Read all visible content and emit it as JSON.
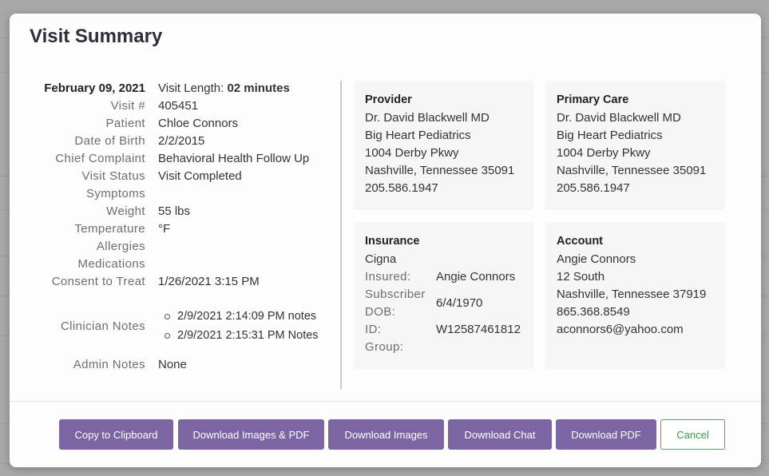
{
  "modal": {
    "title": "Visit Summary"
  },
  "visit": {
    "date": "February 09, 2021",
    "length_label": "Visit Length:",
    "length_value": "02 minutes",
    "fields": [
      {
        "label": "Visit #",
        "value": "405451"
      },
      {
        "label": "Patient",
        "value": "Chloe Connors"
      },
      {
        "label": "Date of Birth",
        "value": "2/2/2015"
      },
      {
        "label": "Chief Complaint",
        "value": "Behavioral Health Follow Up"
      },
      {
        "label": "Visit Status",
        "value": "Visit Completed"
      },
      {
        "label": "Symptoms",
        "value": ""
      },
      {
        "label": "Weight",
        "value": "55 lbs"
      },
      {
        "label": "Temperature",
        "value": "°F"
      },
      {
        "label": "Allergies",
        "value": ""
      },
      {
        "label": "Medications",
        "value": ""
      },
      {
        "label": "Consent to Treat",
        "value": "1/26/2021 3:15 PM"
      }
    ],
    "clinician_notes_label": "Clinician Notes",
    "clinician_notes": [
      "2/9/2021 2:14:09 PM notes",
      "2/9/2021 2:15:31 PM Notes"
    ],
    "admin_notes_label": "Admin Notes",
    "admin_notes": "None"
  },
  "provider": {
    "title": "Provider",
    "lines": [
      "Dr. David Blackwell MD",
      "Big Heart Pediatrics",
      "1004 Derby Pkwy",
      "Nashville, Tennessee 35091",
      "205.586.1947"
    ]
  },
  "primary_care": {
    "title": "Primary Care",
    "lines": [
      "Dr. David Blackwell MD",
      "Big Heart Pediatrics",
      "1004 Derby Pkwy",
      "Nashville, Tennessee 35091",
      "205.586.1947"
    ]
  },
  "insurance": {
    "title": "Insurance",
    "carrier": "Cigna",
    "insured_label": "Insured:",
    "insured_value": "Angie Connors",
    "subscriber_label": "Subscriber",
    "dob_label": "DOB:",
    "dob_value": "6/4/1970",
    "id_label": "ID:",
    "id_value": "W12587461812",
    "group_label": "Group:",
    "group_value": ""
  },
  "account": {
    "title": "Account",
    "lines": [
      "Angie Connors",
      "12 South",
      "Nashville, Tennessee 37919",
      "865.368.8549",
      "aconnors6@yahoo.com"
    ]
  },
  "buttons": {
    "copy": "Copy to Clipboard",
    "download_images_pdf": "Download Images & PDF",
    "download_images": "Download Images",
    "download_chat": "Download Chat",
    "download_pdf": "Download PDF",
    "cancel": "Cancel"
  },
  "colors": {
    "button_primary": "#7b65a3",
    "cancel_border": "#3fae52",
    "overlay": "#a8a8a8"
  }
}
